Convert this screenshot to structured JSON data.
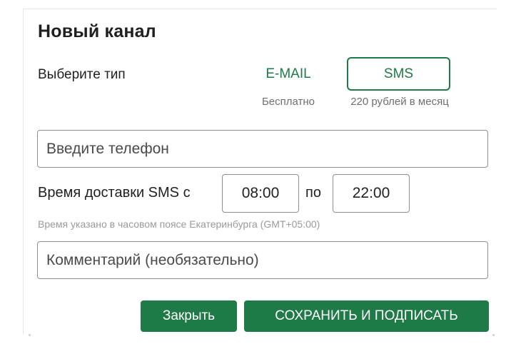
{
  "dialog": {
    "title": "Новый канал",
    "type_label": "Выберите тип",
    "options": [
      {
        "label": "E-MAIL",
        "price": "Бесплатно",
        "selected": false
      },
      {
        "label": "SMS",
        "price": "220 рублей в месяц",
        "selected": true
      }
    ],
    "phone_field": {
      "placeholder": "Введите телефон",
      "value": ""
    },
    "delivery": {
      "label": "Время доставки SMS с",
      "from": "08:00",
      "to_label": "по",
      "to": "22:00",
      "note": "Время указано в часовом поясе Екатеринбурга (GMT+05:00)"
    },
    "comment_field": {
      "placeholder": "Комментарий (необязательно)",
      "value": ""
    },
    "buttons": {
      "close": "Закрыть",
      "save": "СОХРАНИТЬ И ПОДПИСАТЬ"
    }
  },
  "colors": {
    "accent": "#1e7a47",
    "text": "#1f1f1f",
    "muted": "#6f6f6f",
    "hint": "#9a9a9a",
    "border": "#8f8f8f"
  }
}
